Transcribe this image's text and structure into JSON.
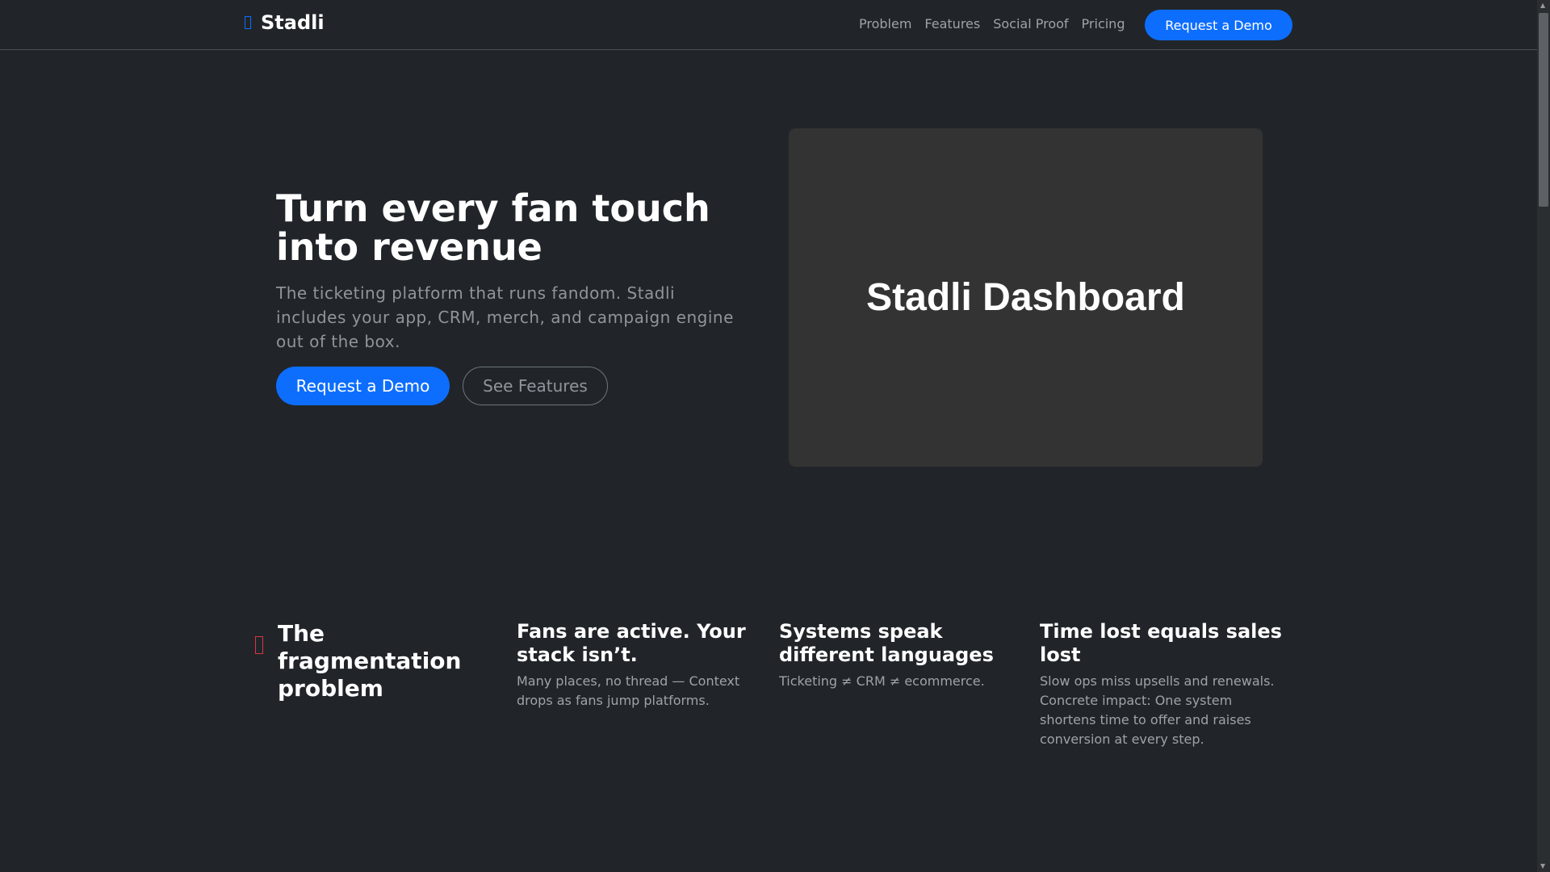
{
  "nav": {
    "brand": "Stadli",
    "brand_icon": "missing-glyph-icon",
    "links": [
      "Problem",
      "Features",
      "Social Proof",
      "Pricing"
    ],
    "cta": "Request a Demo"
  },
  "hero": {
    "title": "Turn every fan touch into revenue",
    "subtitle": "The ticketing platform that runs fandom. Stadli includes your app, CRM, merch, and campaign engine out of the box.",
    "primary": "Request a Demo",
    "secondary": "See Features",
    "image_text": "Stadli Dashboard"
  },
  "problem": {
    "title": "The fragmentation problem",
    "icon_color": "#dc3545",
    "cols": [
      {
        "title": "Fans are active. Your stack isn’t.",
        "text": "Many places, no thread — Context drops as fans jump platforms."
      },
      {
        "title": "Systems speak different languages",
        "text": "Ticketing ≠ CRM ≠ ecommerce."
      },
      {
        "title": "Time lost equals sales lost",
        "text": "Slow ops miss upsells and renewals. Concrete impact: One system shortens time to offer and raises conversion at every step."
      }
    ]
  },
  "colors": {
    "accent": "#0d6efd",
    "background": "#212529"
  }
}
